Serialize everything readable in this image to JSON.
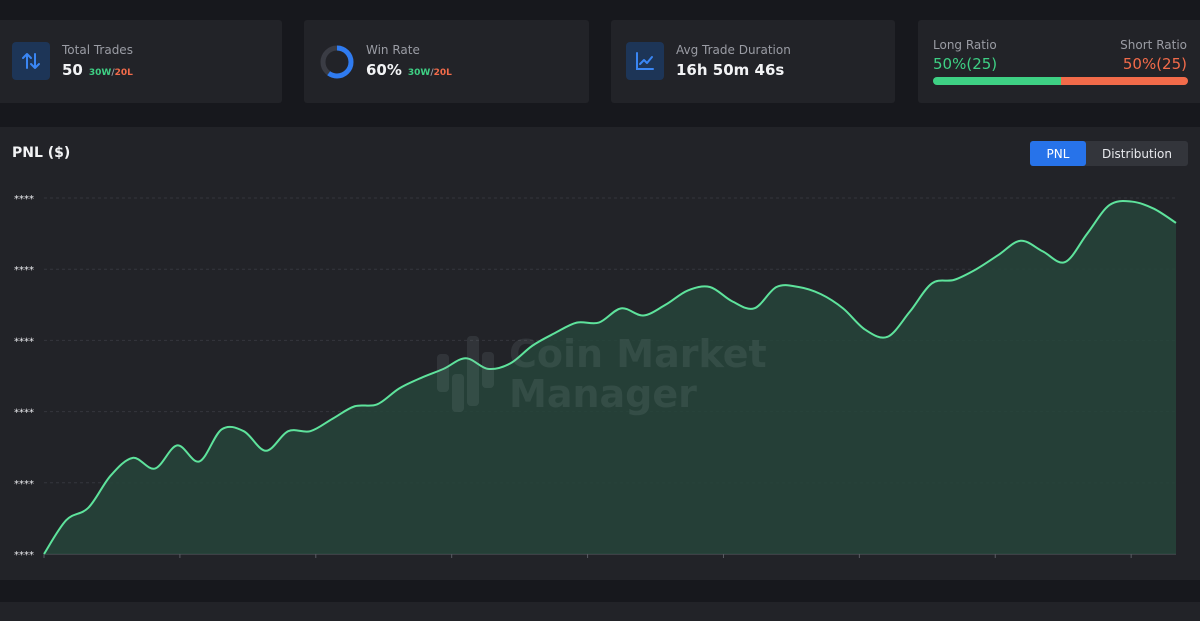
{
  "stats": {
    "total_trades": {
      "label": "Total Trades",
      "value": "50",
      "wins": "30W",
      "sep": "/",
      "losses": "20L",
      "icon": "swap-arrows-icon"
    },
    "win_rate": {
      "label": "Win Rate",
      "value": "60%",
      "wins": "30W",
      "sep": "/",
      "losses": "20L",
      "ring_fraction": 0.6,
      "icon": "win-rate-ring-icon"
    },
    "avg_duration": {
      "label": "Avg Trade Duration",
      "value": "16h 50m 46s",
      "icon": "line-chart-icon"
    },
    "ratio": {
      "long_label": "Long Ratio",
      "long_value": "50%(25)",
      "short_label": "Short Ratio",
      "short_value": "50%(25)",
      "long_fraction": 0.5
    }
  },
  "colors": {
    "accent": "#2773ea",
    "win": "#3ed084",
    "loss": "#f26b4a",
    "line": "#5ee39c",
    "area": "#26443a"
  },
  "pnl": {
    "title": "PNL ($)",
    "toggle": {
      "active": "PNL",
      "inactive": "Distribution"
    },
    "watermark": {
      "line1": "Coin Market",
      "line2": "Manager"
    }
  },
  "chart_data": {
    "type": "area",
    "title": "PNL ($)",
    "xlabel": "",
    "ylabel": "",
    "y_tick_labels": [
      "****",
      "****",
      "****",
      "****",
      "****",
      "****"
    ],
    "ylim": [
      0,
      100
    ],
    "grid": true,
    "x": [
      0,
      1,
      2,
      3,
      4,
      5,
      6,
      7,
      8,
      9,
      10,
      11,
      12,
      13,
      14,
      15,
      16,
      17,
      18,
      19,
      20,
      21,
      22,
      23,
      24,
      25,
      26,
      27,
      28,
      29,
      30,
      31,
      32,
      33,
      34,
      35,
      36,
      37,
      38,
      39,
      40,
      41,
      42,
      43,
      44,
      45,
      46,
      47,
      48,
      49,
      50,
      51
    ],
    "values": [
      0,
      9.5,
      13,
      22,
      27,
      24,
      30.5,
      26,
      35,
      34.5,
      29,
      34.5,
      34.5,
      38,
      41.5,
      42,
      46.5,
      49.5,
      52,
      55,
      52,
      53.5,
      58.5,
      62,
      65,
      65,
      69,
      67,
      70,
      74,
      75,
      71,
      69,
      75,
      75,
      73,
      69,
      63,
      61,
      68,
      76,
      77,
      80,
      84,
      88,
      85,
      82,
      90,
      98,
      99,
      97,
      93
    ]
  }
}
